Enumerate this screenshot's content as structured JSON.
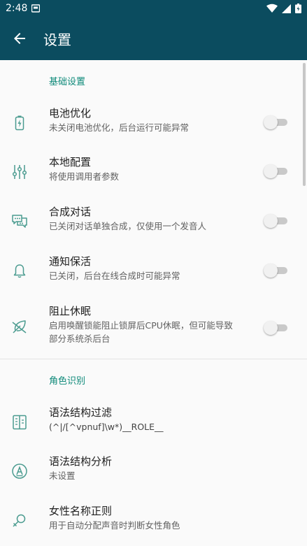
{
  "status_bar": {
    "time": "2:48",
    "icons": [
      "notification-icon",
      "wifi-icon",
      "signal-icon",
      "battery-icon"
    ]
  },
  "app_bar": {
    "back_icon": "arrow-back-icon",
    "title": "设置",
    "color": "#0b4c5f"
  },
  "accent_color": "#0f8a7a",
  "sections": [
    {
      "header": "基础设置",
      "items": [
        {
          "title": "电池优化",
          "summary": "未关闭电池优化，后台运行可能异常",
          "icon": "battery-charging-icon",
          "toggle": false
        },
        {
          "title": "本地配置",
          "summary": "将使用调用者参数",
          "icon": "sliders-icon",
          "toggle": false
        },
        {
          "title": "合成对话",
          "summary": "已关闭对话单独合成，仅使用一个发音人",
          "icon": "chat-icon",
          "toggle": false
        },
        {
          "title": "通知保活",
          "summary": "已关闭，后台在线合成时可能异常",
          "icon": "bell-icon",
          "toggle": false
        },
        {
          "title": "阻止休眠",
          "summary_line1": "启用唤醒锁能阻止锁屏后CPU休眠，但可能导致",
          "summary_line2": "部分系统杀后台",
          "icon": "leaf-off-icon",
          "toggle": false
        }
      ]
    },
    {
      "header": "角色识别",
      "items": [
        {
          "title": "语法结构过滤",
          "summary": "(^|/[^vpnuf]\\w*)__ROLE__",
          "icon": "filter-book-icon"
        },
        {
          "title": "语法结构分析",
          "summary": "未设置",
          "icon": "circle-a-icon"
        },
        {
          "title": "女性名称正则",
          "summary": "用于自动分配声音时判断女性角色",
          "icon": "female-search-icon"
        }
      ]
    }
  ]
}
